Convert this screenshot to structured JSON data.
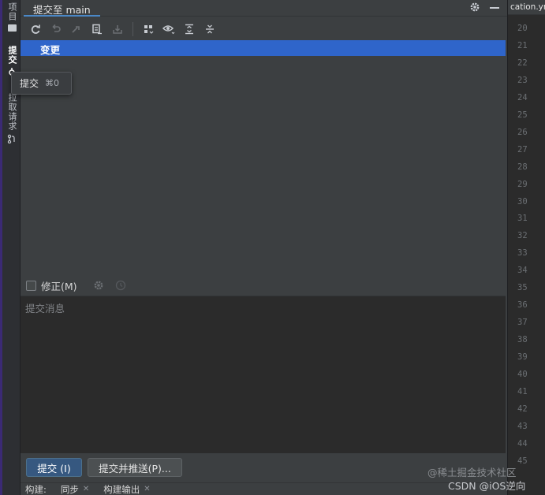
{
  "sidebar": {
    "tabs": [
      {
        "label": "项目",
        "icon": "folder-icon"
      },
      {
        "label": "提交",
        "icon": "commit-icon",
        "active": true
      },
      {
        "label": "拉取请求",
        "icon": "pull-request-icon"
      }
    ]
  },
  "panel": {
    "title": "提交至 main",
    "toolbar_icons": [
      "refresh-icon",
      "rollback-icon",
      "update-icon",
      "diff-icon",
      "shelve-icon",
      "group-by-icon",
      "show-options-icon",
      "expand-all-icon",
      "collapse-all-icon"
    ],
    "changes_label": "变更",
    "tooltip": {
      "label": "提交",
      "shortcut": "⌘0"
    },
    "amend_label": "修正(M)",
    "amend_checked": false,
    "message_placeholder": "提交消息",
    "commit_button": "提交 (I)",
    "commit_push_button": "提交并推送(P)...",
    "bottom_tabs": [
      {
        "label": "构建:"
      },
      {
        "label": "同步"
      },
      {
        "label": "构建输出"
      }
    ]
  },
  "editor": {
    "tab_label": "cation.yml",
    "line_numbers": [
      "20",
      "21",
      "22",
      "23",
      "24",
      "25",
      "26",
      "27",
      "28",
      "29",
      "30",
      "31",
      "32",
      "33",
      "34",
      "35",
      "36",
      "37",
      "38",
      "39",
      "40",
      "41",
      "42",
      "43",
      "44",
      "45"
    ]
  },
  "watermark": {
    "line1": "@稀土掘金技术社区",
    "line2": "CSDN @iOS逆向"
  },
  "colors": {
    "selection": "#2f65ca",
    "primary_button": "#365880",
    "accent_tab": "#4a88c7"
  }
}
